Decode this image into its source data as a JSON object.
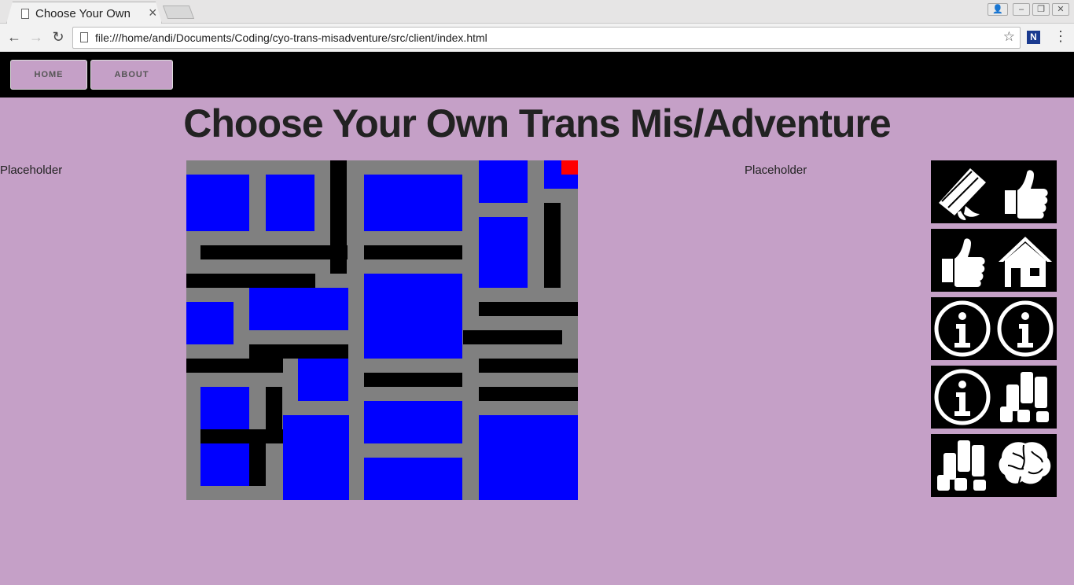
{
  "browser": {
    "tab_title": "Choose Your Own Trans Mis/Adventure",
    "tab_close": "×",
    "url": "file:///home/andi/Documents/Coding/cyo-trans-misadventure/src/client/index.html",
    "back": "←",
    "forward": "→",
    "reload": "↻",
    "star": "☆",
    "extension": "N",
    "menu": "⋮",
    "win_user": "👤",
    "win_min": "–",
    "win_max": "❐",
    "win_close": "✕"
  },
  "nav": {
    "home_label": "HOME",
    "about_label": "ABOUT"
  },
  "page": {
    "title": "Choose Your Own Trans Mis/Adventure",
    "left_placeholder": "Placeholder",
    "right_placeholder": "Placeholder"
  },
  "map": {
    "colors": {
      "path": "#808080",
      "room": "#0000ff",
      "wall": "#000000",
      "player": "#ff0000"
    },
    "grid_units": {
      "cols": 28,
      "rows": 24
    },
    "cells": [
      {
        "kind": "room",
        "c": 0,
        "r": 1,
        "w": 4.5,
        "h": 4
      },
      {
        "kind": "room",
        "c": 5.7,
        "r": 1,
        "w": 3.5,
        "h": 4
      },
      {
        "kind": "wall",
        "c": 10.3,
        "r": 0,
        "w": 1.2,
        "h": 8
      },
      {
        "kind": "room",
        "c": 12.7,
        "r": 1,
        "w": 7,
        "h": 4
      },
      {
        "kind": "room",
        "c": 20.9,
        "r": 0,
        "w": 3.5,
        "h": 3
      },
      {
        "kind": "room",
        "c": 25.6,
        "r": 0,
        "w": 2.4,
        "h": 2
      },
      {
        "kind": "player",
        "c": 26.8,
        "r": 0,
        "w": 1.2,
        "h": 1
      },
      {
        "kind": "wall",
        "c": 1,
        "r": 6,
        "w": 10.5,
        "h": 1
      },
      {
        "kind": "wall",
        "c": 12.7,
        "r": 6,
        "w": 7,
        "h": 1
      },
      {
        "kind": "room",
        "c": 20.9,
        "r": 4,
        "w": 3.5,
        "h": 5
      },
      {
        "kind": "wall",
        "c": 25.6,
        "r": 3,
        "w": 1.2,
        "h": 6
      },
      {
        "kind": "wall",
        "c": 0,
        "r": 8,
        "w": 9.2,
        "h": 1
      },
      {
        "kind": "room",
        "c": 12.7,
        "r": 8,
        "w": 7,
        "h": 6
      },
      {
        "kind": "room",
        "c": 0,
        "r": 10,
        "w": 3.4,
        "h": 3
      },
      {
        "kind": "room",
        "c": 4.5,
        "r": 9,
        "w": 7.1,
        "h": 3
      },
      {
        "kind": "wall",
        "c": 20.9,
        "r": 10,
        "w": 7.1,
        "h": 1
      },
      {
        "kind": "wall",
        "c": 19.8,
        "r": 12,
        "w": 7.1,
        "h": 1
      },
      {
        "kind": "wall",
        "c": 4.5,
        "r": 13,
        "w": 7.1,
        "h": 1
      },
      {
        "kind": "wall",
        "c": 0,
        "r": 14,
        "w": 6.9,
        "h": 1
      },
      {
        "kind": "room",
        "c": 8,
        "r": 14,
        "w": 3.6,
        "h": 3
      },
      {
        "kind": "wall",
        "c": 20.9,
        "r": 14,
        "w": 7.1,
        "h": 1
      },
      {
        "kind": "wall",
        "c": 12.7,
        "r": 15,
        "w": 7,
        "h": 1
      },
      {
        "kind": "room",
        "c": 1,
        "r": 16,
        "w": 3.5,
        "h": 3
      },
      {
        "kind": "wall",
        "c": 5.7,
        "r": 16,
        "w": 1.2,
        "h": 4
      },
      {
        "kind": "wall",
        "c": 20.9,
        "r": 16,
        "w": 7.1,
        "h": 1
      },
      {
        "kind": "room",
        "c": 12.7,
        "r": 17,
        "w": 7,
        "h": 3
      },
      {
        "kind": "room",
        "c": 6.9,
        "r": 18,
        "w": 4.7,
        "h": 6
      },
      {
        "kind": "room",
        "c": 20.9,
        "r": 18,
        "w": 7.1,
        "h": 6
      },
      {
        "kind": "wall",
        "c": 1,
        "r": 19,
        "w": 5.9,
        "h": 1
      },
      {
        "kind": "room",
        "c": 1,
        "r": 20,
        "w": 3.5,
        "h": 3
      },
      {
        "kind": "wall",
        "c": 4.5,
        "r": 20,
        "w": 1.2,
        "h": 3
      },
      {
        "kind": "room",
        "c": 12.7,
        "r": 21,
        "w": 7,
        "h": 3
      }
    ]
  },
  "cards": [
    {
      "left_icon": "diploma-icon",
      "right_icon": "thumbs-up-icon"
    },
    {
      "left_icon": "thumbs-up-icon",
      "right_icon": "house-icon"
    },
    {
      "left_icon": "info-icon",
      "right_icon": "info-icon"
    },
    {
      "left_icon": "info-icon",
      "right_icon": "coins-icon"
    },
    {
      "left_icon": "coins-icon",
      "right_icon": "brain-icon"
    }
  ]
}
